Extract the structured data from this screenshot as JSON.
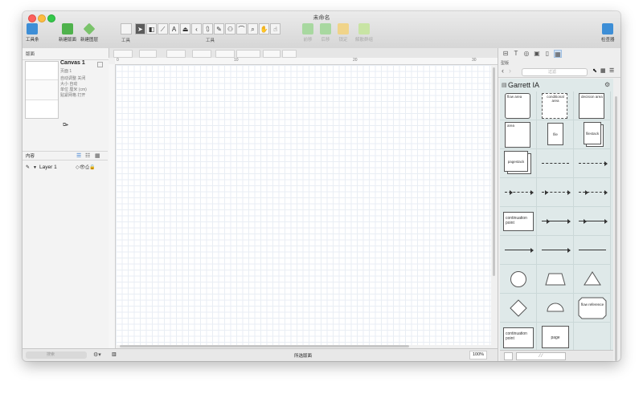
{
  "window": {
    "title": "未命名"
  },
  "toolbar": {
    "toolbar_label": "工具条",
    "new_canvas": "新建版面",
    "new_layer": "新建图层",
    "tools_left_caption": "工具",
    "tools_caption": "工具",
    "front": "前移",
    "back": "后移",
    "lock": "锁定",
    "ungroup": "解散群组",
    "inspector": "检查器",
    "text_tool_glyph": "A"
  },
  "left_panel": {
    "canvases_header": "版面",
    "canvas_name": "Canvas 1",
    "page_count": "页面 1",
    "meta": [
      "自动调整 关闭",
      "大小 自动",
      "单位 厘米 (cm)",
      "贴紧网格 打开"
    ],
    "contents_header": "内容",
    "layer_name": "Layer 1",
    "search_placeholder": "搜索"
  },
  "rulers": {
    "top_ticks": [
      "0",
      "10",
      "20",
      "30"
    ]
  },
  "bottom_bar": {
    "selection": "所选版面",
    "zoom": "100%"
  },
  "right_panel": {
    "section_label": "型版",
    "search_placeholder": "过滤",
    "stencil_name": "Garrett IA",
    "items": [
      "flow area",
      "conditional area",
      "decision area",
      "area",
      "file",
      "filestack",
      "pagestack",
      "continuation point",
      "flow reference",
      "continuation point",
      "page"
    ]
  }
}
